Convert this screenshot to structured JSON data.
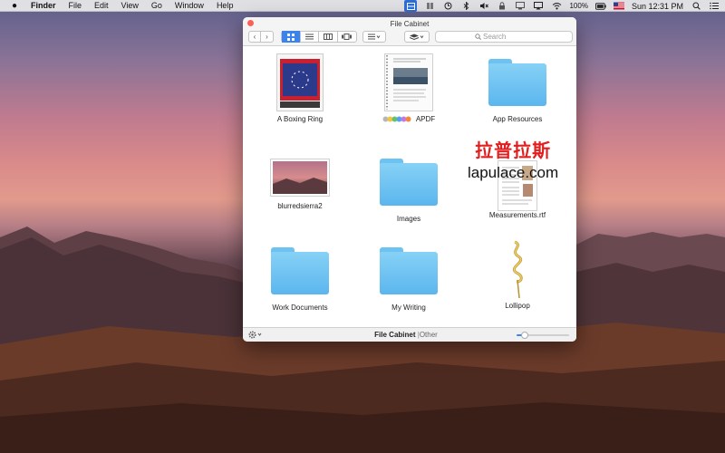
{
  "menubar": {
    "apple_icon": "apple-logo",
    "app_name": "Finder",
    "menus": [
      "File",
      "Edit",
      "View",
      "Go",
      "Window",
      "Help"
    ],
    "battery": "100%",
    "clock": "Sun 12:31 PM"
  },
  "window": {
    "title": "File Cabinet",
    "search_placeholder": "Search",
    "items": [
      {
        "label": "A Boxing Ring",
        "kind": "document"
      },
      {
        "label": "APDF",
        "kind": "pdf"
      },
      {
        "label": "App Resources",
        "kind": "folder"
      },
      {
        "label": "blurredsierra2",
        "kind": "image"
      },
      {
        "label": "Images",
        "kind": "folder"
      },
      {
        "label": "Measurements.rtf",
        "kind": "rtf"
      },
      {
        "label": "Work Documents",
        "kind": "folder"
      },
      {
        "label": "My Writing",
        "kind": "folder"
      },
      {
        "label": "Lollipop",
        "kind": "image"
      }
    ],
    "status": {
      "location": "File Cabinet",
      "separator": "|",
      "sub": "Other",
      "zoom_fraction": 0.15
    }
  },
  "watermark": {
    "chinese": "拉普拉斯",
    "url": "lapulace.com"
  },
  "colors": {
    "accent": "#3b83ef",
    "folder": "#6cc2f0",
    "close": "#fc5f57",
    "watermark_red": "#e02020"
  }
}
